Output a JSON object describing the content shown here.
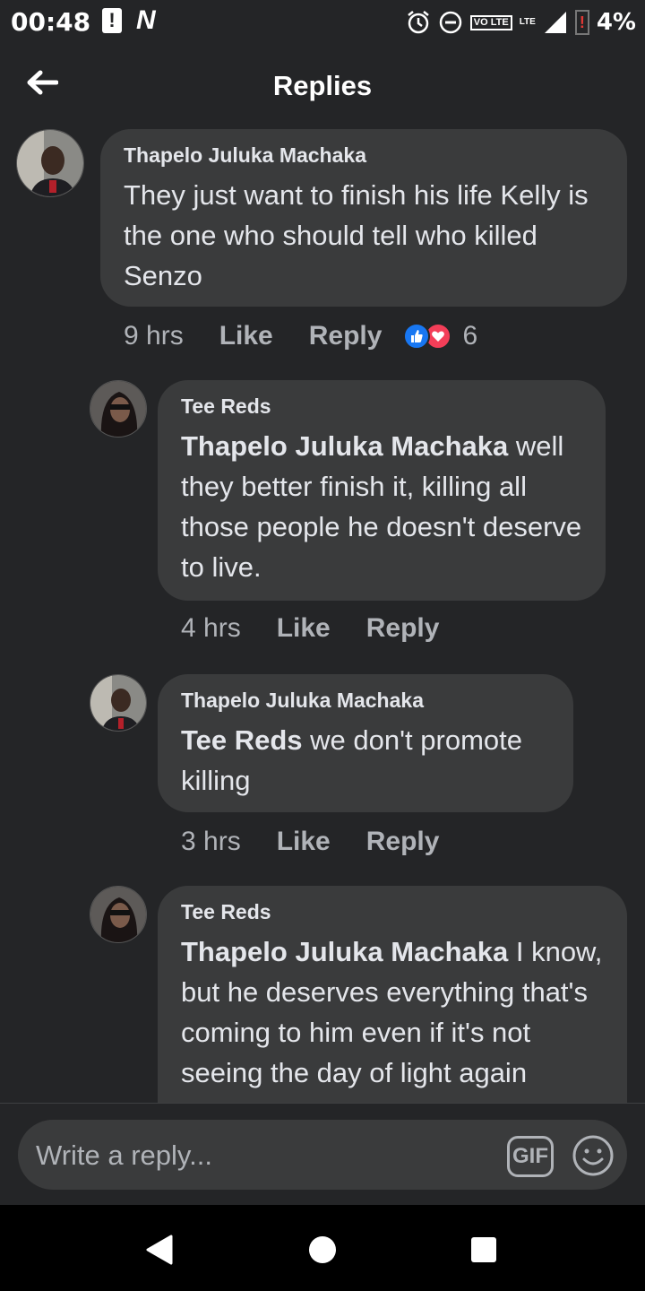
{
  "status_bar": {
    "time": "00:48",
    "alert": "!",
    "notif_letter": "N",
    "volte_label": "VO LTE",
    "lte_label": "LTE",
    "battery": "4%"
  },
  "header": {
    "title": "Replies"
  },
  "comments": [
    {
      "author": "Thapelo Juluka Machaka",
      "mention": "",
      "text": "They just want to finish his life Kelly is the one who should tell who killed Senzo",
      "time": "9 hrs",
      "like": "Like",
      "reply": "Reply",
      "reaction_count": "6"
    },
    {
      "author": "Tee Reds",
      "mention": "Thapelo Juluka Machaka",
      "text": " well they better finish it, killing all those people he doesn't deserve to live.",
      "time": "4 hrs",
      "like": "Like",
      "reply": "Reply"
    },
    {
      "author": "Thapelo Juluka Machaka",
      "mention": "Tee Reds",
      "text": " we don't promote killing",
      "time": "3 hrs",
      "like": "Like",
      "reply": "Reply"
    },
    {
      "author": "Tee Reds",
      "mention": "Thapelo Juluka Machaka",
      "text": " I know, but he deserves everything that's coming to him even if it's not seeing the day of light again",
      "time": "",
      "like": "",
      "reply": ""
    }
  ],
  "reply_input": {
    "placeholder": "Write a reply...",
    "gif_label": "GIF"
  },
  "colors": {
    "background": "#242527",
    "bubble": "#3a3b3c",
    "like_blue": "#1877f2",
    "love_red": "#f33e58"
  }
}
